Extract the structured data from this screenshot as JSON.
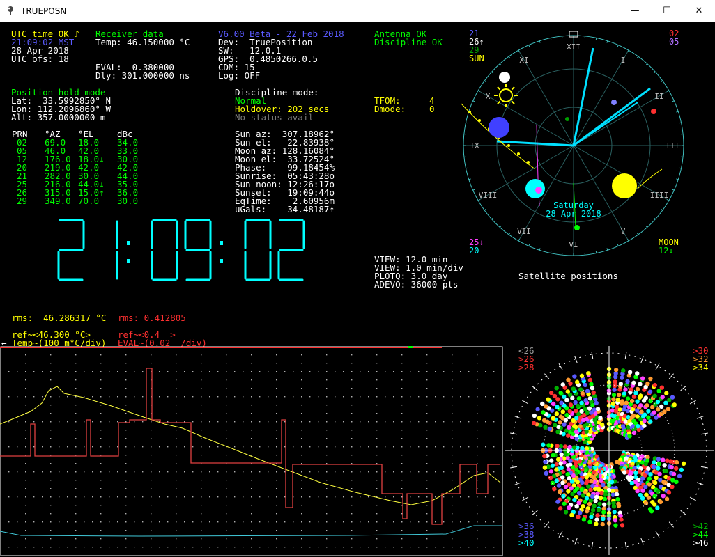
{
  "window": {
    "title": "TRUEPOSN",
    "minimize": "—",
    "maximize": "☐",
    "close": "✕",
    "app_icon": "satellite-dish-icon"
  },
  "status": {
    "utc_line": "UTC time OK ♪",
    "local_time": "21:09:02 MST",
    "date": "28 Apr 2018",
    "utc_ofs": "UTC ofs: 18"
  },
  "receiver": {
    "header": "Receiver data",
    "temp": "Temp: 46.150000 °C",
    "eval": "EVAL:  0.380000",
    "dly": "Dly: 301.000000 ns"
  },
  "version": {
    "header": "V6.00 Beta - 22 Feb 2018",
    "dev": "Dev:  TruePosition",
    "sw": "SW:   12.0.1",
    "gps": "GPS:  0.4850266.0.5",
    "cdm": "CDM: 15",
    "log": "Log: OFF"
  },
  "antenna": {
    "antenna_ok": "Antenna OK",
    "discipline_ok": "Discipline OK",
    "tfom_label": "TFOM:",
    "tfom_value": "4",
    "dmode_label": "Dmode:",
    "dmode_value": "0"
  },
  "position": {
    "header": "Position hold mode",
    "lat": "Lat:  33.5992850° N",
    "lon": "Lon: 112.2096860° W",
    "alt": "Alt: 357.0000000 m"
  },
  "discipline": {
    "header": "Discipline mode:",
    "mode": "Normal",
    "holdover": "Holdover: 202 secs",
    "status": "No status avail"
  },
  "sat_table": {
    "headers": [
      "PRN",
      "°AZ",
      "°EL",
      "dBc"
    ],
    "rows": [
      [
        "02",
        "69.0",
        "18.0",
        "34.0"
      ],
      [
        "05",
        "46.0",
        "42.0",
        "33.0"
      ],
      [
        "12",
        "176.0",
        "18.0↓",
        "30.0"
      ],
      [
        "20",
        "219.0",
        "42.0",
        "42.0"
      ],
      [
        "21",
        "282.0",
        "30.0",
        "44.0"
      ],
      [
        "25",
        "216.0",
        "44.0↓",
        "35.0"
      ],
      [
        "26",
        "315.0",
        "15.0↑",
        "36.0"
      ],
      [
        "29",
        "349.0",
        "70.0",
        "30.0"
      ]
    ]
  },
  "sun_moon": {
    "lines": [
      "Sun az:  307.18962°",
      "Sun el:  -22.83938°",
      "Moon az: 128.16084°",
      "Moon el:  33.72524°",
      "Phase:    99.18454%",
      "Sunrise:  05:43:28o",
      "Sun noon: 12:26:17o",
      "Sunset:   19:09:44o",
      "EqTime:    2.60956m",
      "uGals:    34.48187↑"
    ]
  },
  "clock": {
    "time": "21:09:02"
  },
  "view": {
    "lines": [
      "VIEW: 12.0 min",
      "VIEW: 1.0 min/div",
      "PLOTQ: 3.0 day",
      "ADEVQ: 36000 pts"
    ],
    "satellite_positions_label": "Satellite positions"
  },
  "sat_map": {
    "day": "Saturday",
    "date": "28 Apr 2018",
    "sun_label": "SUN",
    "moon_label": "MOON",
    "hour_labels": [
      "XII",
      "I",
      "II",
      "III",
      "IIII",
      "V",
      "VI",
      "VII",
      "VIII",
      "IX",
      "X",
      "XI"
    ],
    "corner_prns": {
      "top_left": [
        {
          "text": "21",
          "color": "#5a5aff"
        },
        {
          "text": "26↑",
          "color": "#ffffff"
        },
        {
          "text": "29",
          "color": "#00a000"
        }
      ],
      "top_right": [
        {
          "text": "02",
          "color": "#ff3030"
        },
        {
          "text": "05",
          "color": "#b070ff"
        }
      ],
      "bottom_left": [
        {
          "text": "25↓",
          "color": "#ff40ff"
        },
        {
          "text": "20",
          "color": "#00ffff"
        }
      ],
      "bottom_right": [
        {
          "text": "12↓",
          "color": "#00ff00"
        }
      ]
    }
  },
  "rms": {
    "temp_rms": "rms:  46.286317 °C",
    "eval_rms": "rms: 0.412805"
  },
  "graph": {
    "temp_ref": "ref~<46.300 °C>",
    "temp_scale": "Temp~(100 m°C/div)",
    "eval_ref": "ref~<0.4  >",
    "eval_scale": "EVAL~(0.02  /div)",
    "left_arrow": "←"
  },
  "signal_map": {
    "left_labels": [
      {
        "text": "<26",
        "color": "#9a9a9a"
      },
      {
        "text": ">26",
        "color": "#ff3030"
      },
      {
        "text": ">28",
        "color": "#ff3030"
      },
      {
        "text": ">36",
        "color": "#5a5aff"
      },
      {
        "text": ">38",
        "color": "#5a5aff"
      },
      {
        "text": ">40",
        "color": "#00ffff"
      }
    ],
    "right_labels": [
      {
        "text": ">30",
        "color": "#ff3030"
      },
      {
        "text": ">32",
        "color": "#ff9a30"
      },
      {
        "text": ">34",
        "color": "#ffff00"
      },
      {
        "text": ">42",
        "color": "#00b000"
      },
      {
        "text": ">44",
        "color": "#00ff00"
      },
      {
        "text": ">46",
        "color": "#ffffff"
      }
    ]
  }
}
